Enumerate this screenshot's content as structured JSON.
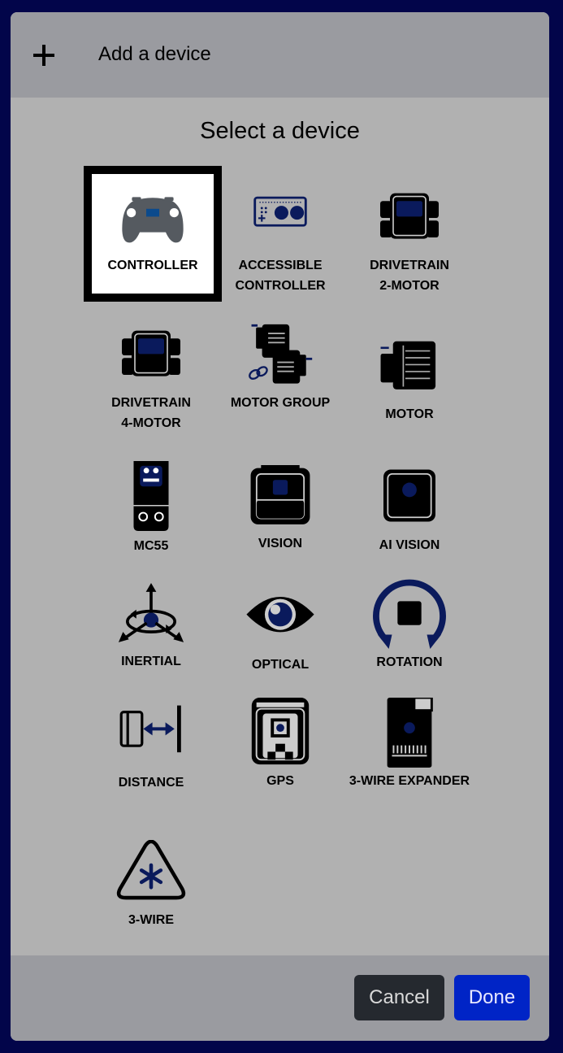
{
  "header": {
    "title": "Add a device",
    "icon": "plus-icon"
  },
  "select_title": "Select a device",
  "devices": [
    {
      "label": "CONTROLLER",
      "icon": "controller-icon",
      "selected": true
    },
    {
      "label": "ACCESSIBLE CONTROLLER",
      "icon": "accessible-controller-icon",
      "selected": false
    },
    {
      "label": "DRIVETRAIN 2-MOTOR",
      "icon": "drivetrain-2-motor-icon",
      "selected": false
    },
    {
      "label": "DRIVETRAIN 4-MOTOR",
      "icon": "drivetrain-4-motor-icon",
      "selected": false
    },
    {
      "label": "MOTOR GROUP",
      "icon": "motor-group-icon",
      "selected": false
    },
    {
      "label": "MOTOR",
      "icon": "motor-icon",
      "selected": false
    },
    {
      "label": "MC55",
      "icon": "mc55-icon",
      "selected": false
    },
    {
      "label": "VISION",
      "icon": "vision-icon",
      "selected": false
    },
    {
      "label": "AI VISION",
      "icon": "ai-vision-icon",
      "selected": false
    },
    {
      "label": "INERTIAL",
      "icon": "inertial-icon",
      "selected": false
    },
    {
      "label": "OPTICAL",
      "icon": "optical-icon",
      "selected": false
    },
    {
      "label": "ROTATION",
      "icon": "rotation-icon",
      "selected": false
    },
    {
      "label": "DISTANCE",
      "icon": "distance-icon",
      "selected": false
    },
    {
      "label": "GPS",
      "icon": "gps-icon",
      "selected": false
    },
    {
      "label": "3-WIRE EXPANDER",
      "icon": "3-wire-expander-icon",
      "selected": false
    },
    {
      "label": "3-WIRE",
      "icon": "3-wire-icon",
      "selected": false
    }
  ],
  "footer": {
    "cancel_label": "Cancel",
    "done_label": "Done"
  },
  "colors": {
    "backdrop": "#02054a",
    "panel": "#b1b1b1",
    "bar": "#9a9ba0",
    "accent_navy": "#0a1a5c",
    "done_button": "#0024c6",
    "cancel_button": "#25292f"
  }
}
